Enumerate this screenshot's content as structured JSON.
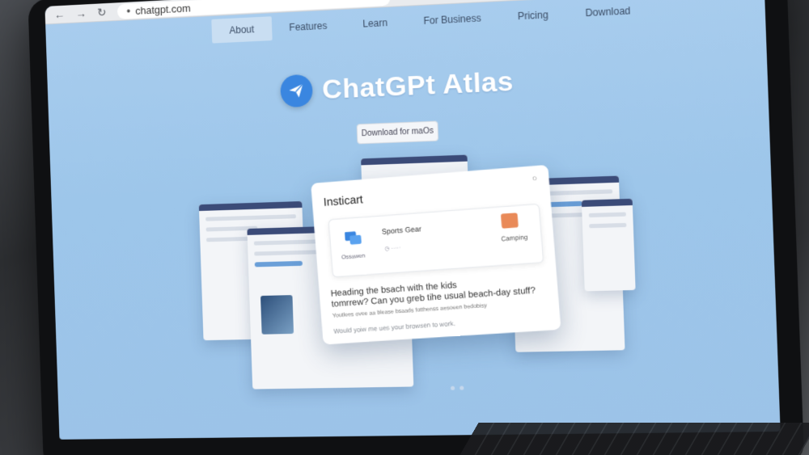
{
  "browser": {
    "back_icon": "arrow-left-icon",
    "forward_icon": "arrow-right-icon",
    "reload_icon": "reload-icon",
    "url": "chatgpt.com"
  },
  "nav": {
    "items": [
      {
        "label": "About",
        "active": true
      },
      {
        "label": "Features",
        "active": false
      },
      {
        "label": "Learn",
        "active": false
      },
      {
        "label": "For Business",
        "active": false
      },
      {
        "label": "Pricing",
        "active": false
      },
      {
        "label": "Download",
        "active": false
      }
    ]
  },
  "hero": {
    "title": "ChatGPt Atlas",
    "logo_icon": "paper-plane-icon",
    "brand_color": "#3a86e0",
    "download_label": "Download for maOs"
  },
  "card": {
    "title": "Insticart",
    "item_title": "Sports Gear",
    "left_label": "Ossawen",
    "right_label": "Camping",
    "prompt_line1": "Heading the bsach with the kids",
    "prompt_line2": "tomrrew? Can you greb tihe usual beach-day stuff?",
    "prompt_sub": "Youtlees ovee aa blease bsaads fotthenss aesoeen bedobisy",
    "prompt_foot": "Would yoiw me ues your browsen to work."
  }
}
